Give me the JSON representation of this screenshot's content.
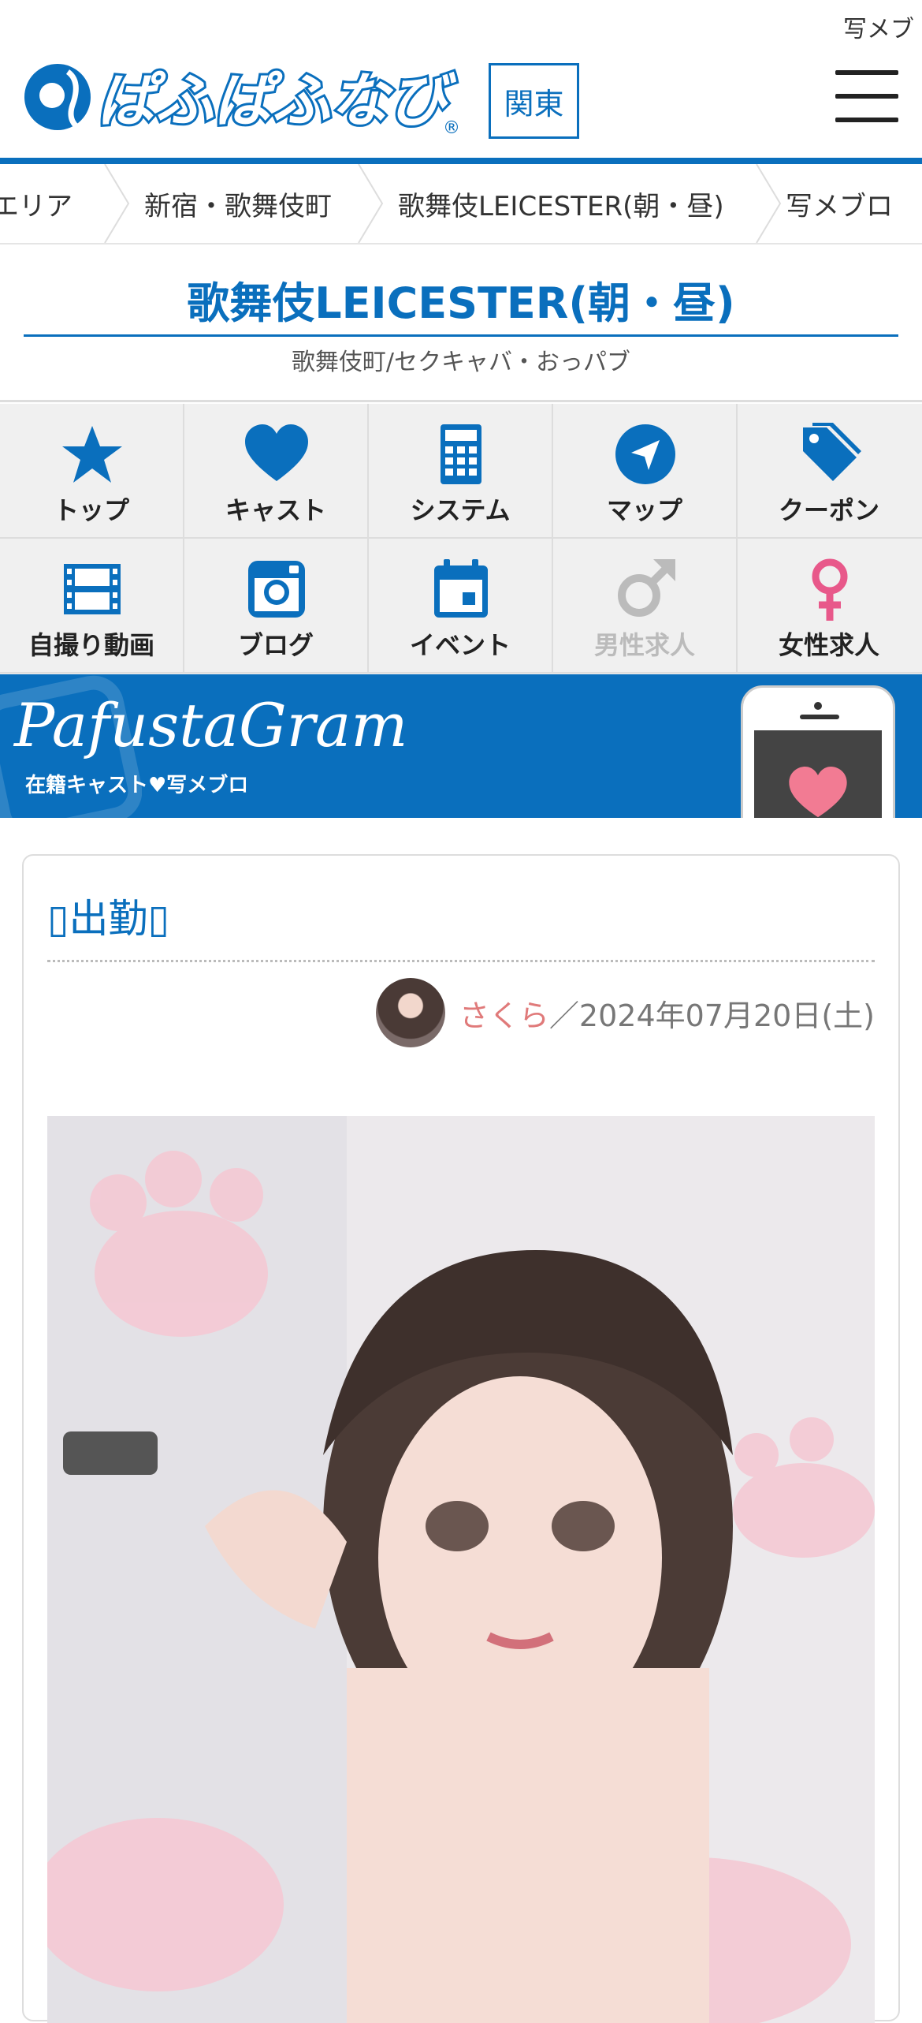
{
  "page_title_fragment": "写メブ",
  "header": {
    "logo_text": "ぱふぱふなび",
    "region": "関東"
  },
  "breadcrumb": [
    "エリア",
    "新宿・歌舞伎町",
    "歌舞伎LEICESTER(朝・昼)",
    "写メブロ"
  ],
  "shop": {
    "name": "歌舞伎LEICESTER(朝・昼)",
    "category": "歌舞伎町/セクキャバ・おっパブ"
  },
  "nav": [
    {
      "label": "トップ",
      "icon": "star-icon"
    },
    {
      "label": "キャスト",
      "icon": "heart-icon"
    },
    {
      "label": "システム",
      "icon": "calculator-icon"
    },
    {
      "label": "マップ",
      "icon": "navigation-icon"
    },
    {
      "label": "クーポン",
      "icon": "tag-icon"
    },
    {
      "label": "自撮り動画",
      "icon": "film-icon"
    },
    {
      "label": "ブログ",
      "icon": "instagram-icon"
    },
    {
      "label": "イベント",
      "icon": "calendar-icon"
    },
    {
      "label": "男性求人",
      "icon": "male-icon",
      "disabled": true
    },
    {
      "label": "女性求人",
      "icon": "female-icon"
    }
  ],
  "banner": {
    "title": "PafustaGram",
    "subtitle": "在籍キャスト♥写メブロ"
  },
  "post": {
    "title": "▯出勤▯",
    "author": "さくら",
    "separator": "／",
    "date": "2024年07月20日(土)"
  },
  "colors": {
    "brand": "#0a6fbd",
    "author": "#e07a7a",
    "female": "#e8588a",
    "disabled": "#bbbbbb"
  }
}
